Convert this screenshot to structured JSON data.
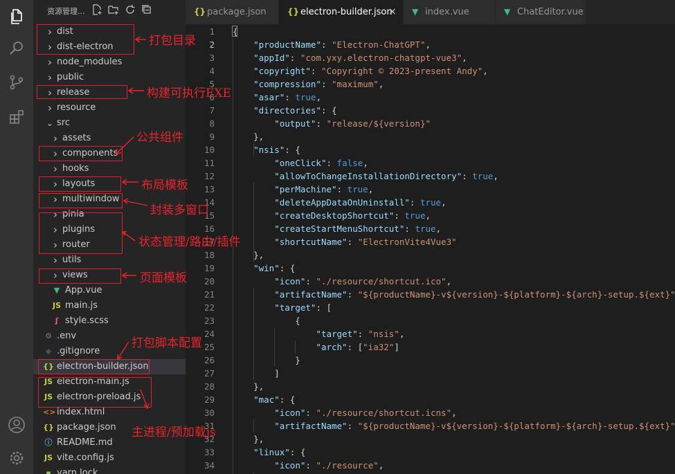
{
  "explorer": {
    "title": "资源管理...",
    "tree": [
      {
        "label": "dist",
        "kind": "folder",
        "open": false,
        "indent": 0
      },
      {
        "label": "dist-electron",
        "kind": "folder",
        "open": false,
        "indent": 0
      },
      {
        "label": "node_modules",
        "kind": "folder",
        "open": false,
        "indent": 0
      },
      {
        "label": "public",
        "kind": "folder",
        "open": false,
        "indent": 0
      },
      {
        "label": "release",
        "kind": "folder",
        "open": false,
        "indent": 0
      },
      {
        "label": "resource",
        "kind": "folder",
        "open": false,
        "indent": 0
      },
      {
        "label": "src",
        "kind": "folder",
        "open": true,
        "indent": 0
      },
      {
        "label": "assets",
        "kind": "folder",
        "open": false,
        "indent": 1
      },
      {
        "label": "components",
        "kind": "folder",
        "open": false,
        "indent": 1
      },
      {
        "label": "hooks",
        "kind": "folder",
        "open": false,
        "indent": 1
      },
      {
        "label": "layouts",
        "kind": "folder",
        "open": false,
        "indent": 1
      },
      {
        "label": "multiwindow",
        "kind": "folder",
        "open": false,
        "indent": 1
      },
      {
        "label": "pinia",
        "kind": "folder",
        "open": false,
        "indent": 1
      },
      {
        "label": "plugins",
        "kind": "folder",
        "open": false,
        "indent": 1
      },
      {
        "label": "router",
        "kind": "folder",
        "open": false,
        "indent": 1
      },
      {
        "label": "utils",
        "kind": "folder",
        "open": false,
        "indent": 1
      },
      {
        "label": "views",
        "kind": "folder",
        "open": false,
        "indent": 1
      },
      {
        "label": "App.vue",
        "kind": "vue",
        "indent": 1
      },
      {
        "label": "main.js",
        "kind": "js",
        "indent": 1
      },
      {
        "label": "style.scss",
        "kind": "scss",
        "indent": 1
      },
      {
        "label": ".env",
        "kind": "env",
        "indent": 0
      },
      {
        "label": ".gitignore",
        "kind": "git",
        "indent": 0
      },
      {
        "label": "electron-builder.json",
        "kind": "json",
        "indent": 0,
        "active": true
      },
      {
        "label": "electron-main.js",
        "kind": "js",
        "indent": 0
      },
      {
        "label": "electron-preload.js",
        "kind": "js",
        "indent": 0
      },
      {
        "label": "index.html",
        "kind": "html",
        "indent": 0
      },
      {
        "label": "package.json",
        "kind": "json",
        "indent": 0
      },
      {
        "label": "README.md",
        "kind": "info",
        "indent": 0
      },
      {
        "label": "vite.config.js",
        "kind": "js",
        "indent": 0
      },
      {
        "label": "yarn.lock",
        "kind": "lock",
        "indent": 0
      }
    ]
  },
  "tabs": [
    {
      "label": "package.json",
      "icon": "{}",
      "active": false
    },
    {
      "label": "electron-builder.json",
      "icon": "{}",
      "active": true,
      "close": "×"
    },
    {
      "label": "index.vue",
      "icon": "V",
      "active": false
    },
    {
      "label": "ChatEditor.vue",
      "icon": "V",
      "active": false
    }
  ],
  "editor": {
    "current_line": 2,
    "lines": [
      {
        "n": "1",
        "t": [
          [
            "p",
            "{"
          ]
        ]
      },
      {
        "n": "2",
        "t": [
          [
            "p",
            "    "
          ],
          [
            "k",
            "\"productName\""
          ],
          [
            "p",
            ": "
          ],
          [
            "s",
            "\"Electron-ChatGPT\""
          ],
          [
            "p",
            ","
          ]
        ]
      },
      {
        "n": "3",
        "t": [
          [
            "p",
            "    "
          ],
          [
            "k",
            "\"appId\""
          ],
          [
            "p",
            ": "
          ],
          [
            "s",
            "\"com.yxy.electron-chatgpt-vue3\""
          ],
          [
            "p",
            ","
          ]
        ]
      },
      {
        "n": "4",
        "t": [
          [
            "p",
            "    "
          ],
          [
            "k",
            "\"copyright\""
          ],
          [
            "p",
            ": "
          ],
          [
            "s",
            "\"Copyright © 2023-present Andy\""
          ],
          [
            "p",
            ","
          ]
        ]
      },
      {
        "n": "5",
        "t": [
          [
            "p",
            "    "
          ],
          [
            "k",
            "\"compression\""
          ],
          [
            "p",
            ": "
          ],
          [
            "s",
            "\"maximum\""
          ],
          [
            "p",
            ","
          ]
        ]
      },
      {
        "n": "6",
        "t": [
          [
            "p",
            "    "
          ],
          [
            "k",
            "\"asar\""
          ],
          [
            "p",
            ": "
          ],
          [
            "b",
            "true"
          ],
          [
            "p",
            ","
          ]
        ]
      },
      {
        "n": "7",
        "t": [
          [
            "p",
            "    "
          ],
          [
            "k",
            "\"directories\""
          ],
          [
            "p",
            ": {"
          ]
        ]
      },
      {
        "n": "8",
        "t": [
          [
            "p",
            "        "
          ],
          [
            "k",
            "\"output\""
          ],
          [
            "p",
            ": "
          ],
          [
            "s",
            "\"release/${version}\""
          ]
        ]
      },
      {
        "n": "9",
        "t": [
          [
            "p",
            "    },"
          ]
        ]
      },
      {
        "n": "10",
        "t": [
          [
            "p",
            "    "
          ],
          [
            "k",
            "\"nsis\""
          ],
          [
            "p",
            ": {"
          ]
        ]
      },
      {
        "n": "11",
        "t": [
          [
            "p",
            "        "
          ],
          [
            "k",
            "\"oneClick\""
          ],
          [
            "p",
            ": "
          ],
          [
            "b",
            "false"
          ],
          [
            "p",
            ","
          ]
        ]
      },
      {
        "n": "12",
        "t": [
          [
            "p",
            "        "
          ],
          [
            "k",
            "\"allowToChangeInstallationDirectory\""
          ],
          [
            "p",
            ": "
          ],
          [
            "b",
            "true"
          ],
          [
            "p",
            ","
          ]
        ]
      },
      {
        "n": "13",
        "t": [
          [
            "p",
            "        "
          ],
          [
            "k",
            "\"perMachine\""
          ],
          [
            "p",
            ": "
          ],
          [
            "b",
            "true"
          ],
          [
            "p",
            ","
          ]
        ]
      },
      {
        "n": "14",
        "t": [
          [
            "p",
            "        "
          ],
          [
            "k",
            "\"deleteAppDataOnUninstall\""
          ],
          [
            "p",
            ": "
          ],
          [
            "b",
            "true"
          ],
          [
            "p",
            ","
          ]
        ]
      },
      {
        "n": "15",
        "t": [
          [
            "p",
            "        "
          ],
          [
            "k",
            "\"createDesktopShortcut\""
          ],
          [
            "p",
            ": "
          ],
          [
            "b",
            "true"
          ],
          [
            "p",
            ","
          ]
        ]
      },
      {
        "n": "16",
        "t": [
          [
            "p",
            "        "
          ],
          [
            "k",
            "\"createStartMenuShortcut\""
          ],
          [
            "p",
            ": "
          ],
          [
            "b",
            "true"
          ],
          [
            "p",
            ","
          ]
        ]
      },
      {
        "n": "17",
        "t": [
          [
            "p",
            "        "
          ],
          [
            "k",
            "\"shortcutName\""
          ],
          [
            "p",
            ": "
          ],
          [
            "s",
            "\"ElectronVite4Vue3\""
          ]
        ]
      },
      {
        "n": "18",
        "t": [
          [
            "p",
            "    },"
          ]
        ]
      },
      {
        "n": "19",
        "t": [
          [
            "p",
            "    "
          ],
          [
            "k",
            "\"win\""
          ],
          [
            "p",
            ": {"
          ]
        ]
      },
      {
        "n": "20",
        "t": [
          [
            "p",
            "        "
          ],
          [
            "k",
            "\"icon\""
          ],
          [
            "p",
            ": "
          ],
          [
            "s",
            "\"./resource/shortcut.ico\""
          ],
          [
            "p",
            ","
          ]
        ]
      },
      {
        "n": "21",
        "t": [
          [
            "p",
            "        "
          ],
          [
            "k",
            "\"artifactName\""
          ],
          [
            "p",
            ": "
          ],
          [
            "s",
            "\"${productName}-v${version}-${platform}-${arch}-setup.${ext}\""
          ],
          [
            "p",
            ","
          ]
        ]
      },
      {
        "n": "22",
        "t": [
          [
            "p",
            "        "
          ],
          [
            "k",
            "\"target\""
          ],
          [
            "p",
            ": ["
          ]
        ]
      },
      {
        "n": "23",
        "t": [
          [
            "p",
            "            {"
          ]
        ]
      },
      {
        "n": "24",
        "t": [
          [
            "p",
            "                "
          ],
          [
            "k",
            "\"target\""
          ],
          [
            "p",
            ": "
          ],
          [
            "s",
            "\"nsis\""
          ],
          [
            "p",
            ","
          ]
        ]
      },
      {
        "n": "25",
        "t": [
          [
            "p",
            "                "
          ],
          [
            "k",
            "\"arch\""
          ],
          [
            "p",
            ": ["
          ],
          [
            "s",
            "\"ia32\""
          ],
          [
            "p",
            "]"
          ]
        ]
      },
      {
        "n": "26",
        "t": [
          [
            "p",
            "            }"
          ]
        ]
      },
      {
        "n": "27",
        "t": [
          [
            "p",
            "        ]"
          ]
        ]
      },
      {
        "n": "28",
        "t": [
          [
            "p",
            "    },"
          ]
        ]
      },
      {
        "n": "29",
        "t": [
          [
            "p",
            "    "
          ],
          [
            "k",
            "\"mac\""
          ],
          [
            "p",
            ": {"
          ]
        ]
      },
      {
        "n": "30",
        "t": [
          [
            "p",
            "        "
          ],
          [
            "k",
            "\"icon\""
          ],
          [
            "p",
            ": "
          ],
          [
            "s",
            "\"./resource/shortcut.icns\""
          ],
          [
            "p",
            ","
          ]
        ]
      },
      {
        "n": "31",
        "t": [
          [
            "p",
            "        "
          ],
          [
            "k",
            "\"artifactName\""
          ],
          [
            "p",
            ": "
          ],
          [
            "s",
            "\"${productName}-v${version}-${platform}-${arch}-setup.${ext}\""
          ]
        ]
      },
      {
        "n": "32",
        "t": [
          [
            "p",
            "    },"
          ]
        ]
      },
      {
        "n": "33",
        "t": [
          [
            "p",
            "    "
          ],
          [
            "k",
            "\"linux\""
          ],
          [
            "p",
            ": {"
          ]
        ]
      },
      {
        "n": "34",
        "t": [
          [
            "p",
            "        "
          ],
          [
            "k",
            "\"icon\""
          ],
          [
            "p",
            ": "
          ],
          [
            "s",
            "\"./resource\""
          ],
          [
            "p",
            ","
          ]
        ]
      }
    ]
  },
  "annotations": {
    "color": "#e8242c",
    "notes": [
      "打包目录",
      "构建可执行EXE",
      "公共组件",
      "布局模板",
      "封装多窗口",
      "状态管理/路由/插件",
      "页面模板",
      "打包脚本配置",
      "主进程/预加载js"
    ]
  },
  "activity_bar": {
    "icons": [
      "explorer-icon",
      "search-icon",
      "source-control-icon",
      "extensions-icon",
      "account-icon",
      "settings-gear-icon"
    ]
  }
}
